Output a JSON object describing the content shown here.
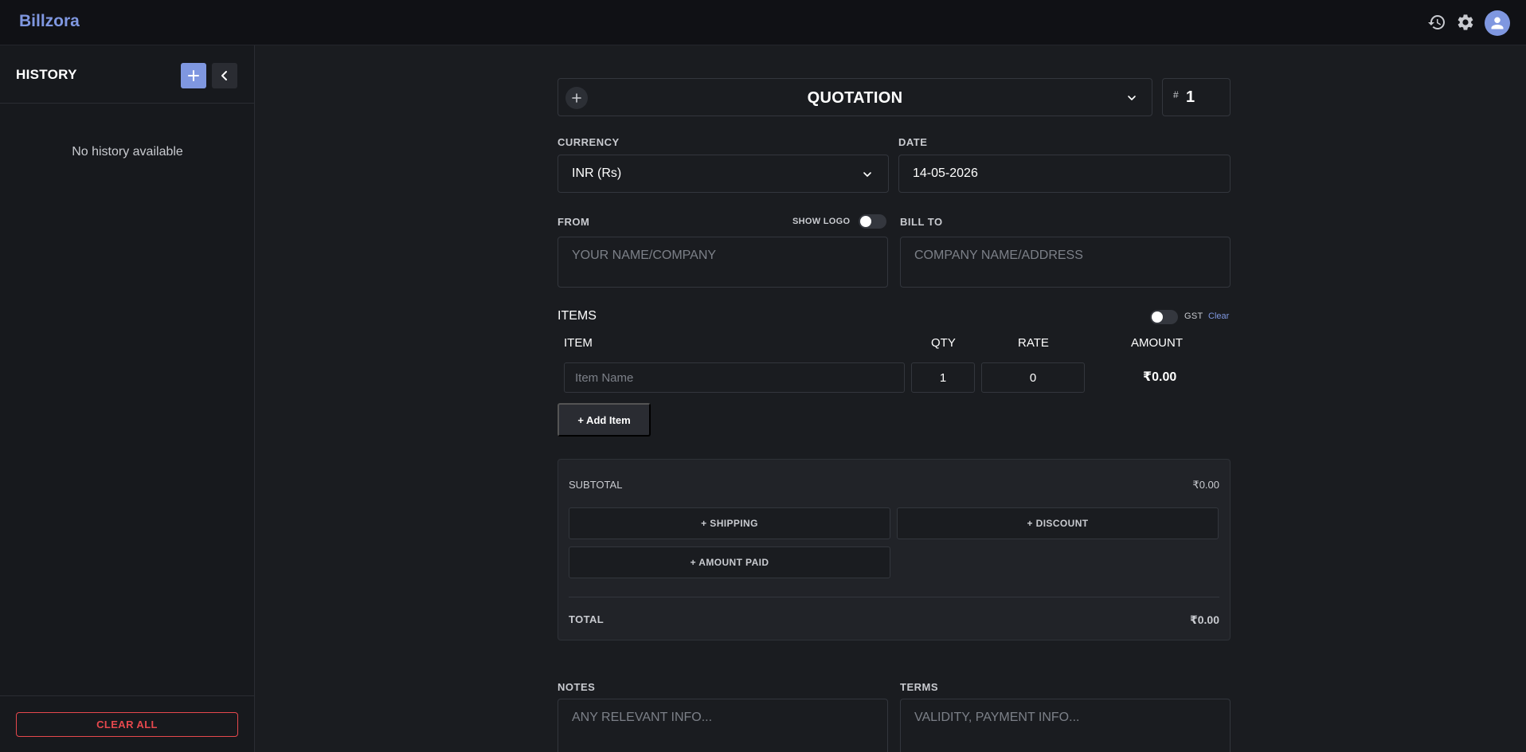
{
  "app": {
    "brand": "Billzora"
  },
  "topbar": {
    "icons": [
      "history-icon",
      "gear-icon",
      "user-icon"
    ]
  },
  "sidebar": {
    "title": "HISTORY",
    "empty_text": "No history available",
    "clear_all": "CLEAR ALL"
  },
  "doc": {
    "type": "QUOTATION",
    "number_prefix": "#",
    "number": "1"
  },
  "currency": {
    "label": "CURRENCY",
    "value": "INR (Rs)"
  },
  "date": {
    "label": "DATE",
    "value": "14-05-2026"
  },
  "from": {
    "label": "FROM",
    "show_logo": "SHOW LOGO",
    "placeholder": "YOUR NAME/COMPANY"
  },
  "bill_to": {
    "label": "BILL TO",
    "placeholder": "COMPANY NAME/ADDRESS"
  },
  "items": {
    "title": "ITEMS",
    "gst_label": "GST",
    "clear": "Clear",
    "columns": {
      "item": "ITEM",
      "qty": "QTY",
      "rate": "RATE",
      "amount": "AMOUNT"
    },
    "rows": [
      {
        "placeholder": "Item Name",
        "qty": "1",
        "rate": "0",
        "amount": "₹0.00"
      }
    ],
    "add_item": "+ Add Item"
  },
  "summary": {
    "subtotal_label": "SUBTOTAL",
    "subtotal_value": "₹0.00",
    "shipping": "+ SHIPPING",
    "discount": "+ DISCOUNT",
    "amount_paid": "+ AMOUNT PAID",
    "total_label": "TOTAL",
    "total_value": "₹0.00"
  },
  "notes": {
    "label": "NOTES",
    "placeholder": "ANY RELEVANT INFO..."
  },
  "terms": {
    "label": "TERMS",
    "placeholder": "VALIDITY, PAYMENT INFO..."
  },
  "colors": {
    "accent": "#7f97e0",
    "danger": "#e5484d",
    "background": "#1a1c20"
  }
}
